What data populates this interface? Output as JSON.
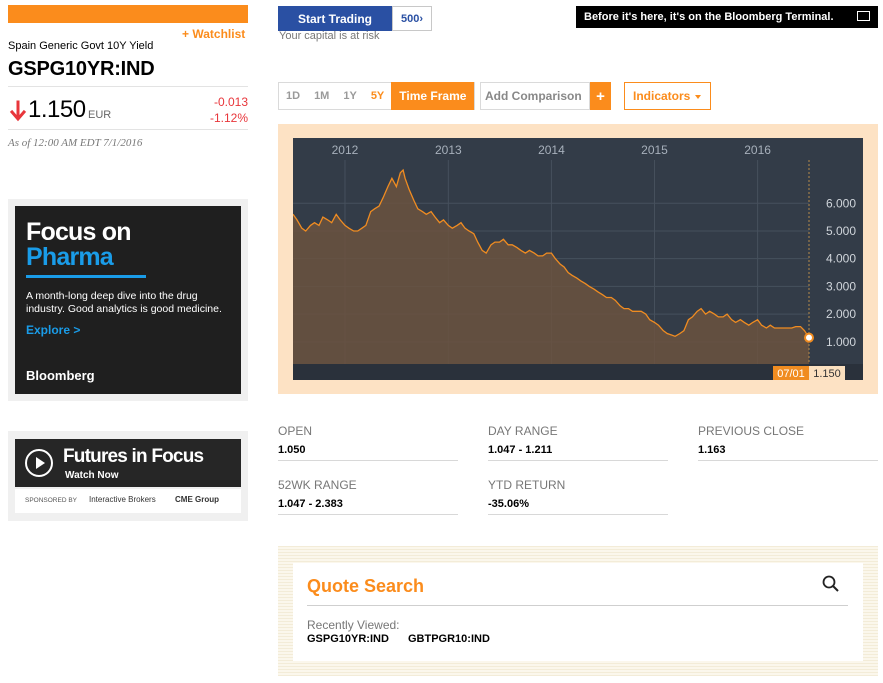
{
  "security": {
    "watchlist_label": "+ Watchlist",
    "name": "Spain Generic Govt 10Y Yield",
    "ticker": "GSPG10YR:IND",
    "price": "1.150",
    "currency": "EUR",
    "change_abs": "-0.013",
    "change_pct": "-1.12%",
    "as_of": "As of 12:00 AM EDT 7/1/2016",
    "direction_icon": "arrow-down-icon",
    "negative_color": "#e8363b"
  },
  "promo": {
    "start_trading": "Start Trading",
    "logo_text": "500›",
    "capital_risk": "Your capital is at risk",
    "terminal_banner": "Before it's here, it's on the Bloomberg Terminal."
  },
  "ads": {
    "pharma": {
      "title_line1": "Focus on",
      "title_line2": "Pharma",
      "body": "A month-long deep dive into the drug industry. Good analytics is good medicine.",
      "cta": "Explore >",
      "brand": "Bloomberg"
    },
    "futures": {
      "title": "Futures in Focus",
      "cta": "Watch Now",
      "sponsored_by": "SPONSORED BY",
      "sponsor1": "Interactive Brokers",
      "sponsor2": "CME Group"
    }
  },
  "toolbar": {
    "timeframes": [
      "1D",
      "1M",
      "1Y",
      "5Y"
    ],
    "active_timeframe": "5Y",
    "timeframe_label": "Time Frame",
    "compare_label": "Add Comparison",
    "compare_plus": "+",
    "indicators_label": "Indicators",
    "accent": "#fb8c1c"
  },
  "chart_data": {
    "type": "area",
    "x_ticks": [
      "2012",
      "2013",
      "2014",
      "2015",
      "2016"
    ],
    "y_ticks": [
      "6.000",
      "5.000",
      "4.000",
      "3.000",
      "2.000",
      "1.000"
    ],
    "ylim": [
      0.2,
      7.2
    ],
    "grid": true,
    "line_color": "#f08c21",
    "fill_color": "#6b5240",
    "background": "#333c48",
    "cursor_date": "07/01",
    "cursor_value": "1.150",
    "x": [
      "2011-07-01",
      "2011-07-15",
      "2011-08-01",
      "2011-08-15",
      "2011-09-01",
      "2011-09-15",
      "2011-10-01",
      "2011-10-15",
      "2011-11-01",
      "2011-11-15",
      "2011-12-01",
      "2011-12-15",
      "2012-01-01",
      "2012-01-15",
      "2012-02-01",
      "2012-02-15",
      "2012-03-01",
      "2012-03-15",
      "2012-04-01",
      "2012-04-15",
      "2012-05-01",
      "2012-05-15",
      "2012-06-01",
      "2012-06-15",
      "2012-07-01",
      "2012-07-15",
      "2012-07-25",
      "2012-08-01",
      "2012-08-15",
      "2012-09-01",
      "2012-09-15",
      "2012-10-01",
      "2012-10-15",
      "2012-11-01",
      "2012-11-15",
      "2012-12-01",
      "2012-12-15",
      "2013-01-01",
      "2013-01-15",
      "2013-02-01",
      "2013-02-15",
      "2013-03-01",
      "2013-03-15",
      "2013-04-01",
      "2013-04-15",
      "2013-05-01",
      "2013-05-15",
      "2013-06-01",
      "2013-06-15",
      "2013-07-01",
      "2013-07-15",
      "2013-08-01",
      "2013-08-15",
      "2013-09-01",
      "2013-09-15",
      "2013-10-01",
      "2013-10-15",
      "2013-11-01",
      "2013-11-15",
      "2013-12-01",
      "2013-12-15",
      "2014-01-01",
      "2014-01-15",
      "2014-02-01",
      "2014-02-15",
      "2014-03-01",
      "2014-03-15",
      "2014-04-01",
      "2014-04-15",
      "2014-05-01",
      "2014-05-15",
      "2014-06-01",
      "2014-06-15",
      "2014-07-01",
      "2014-07-15",
      "2014-08-01",
      "2014-08-15",
      "2014-09-01",
      "2014-09-15",
      "2014-10-01",
      "2014-10-15",
      "2014-11-01",
      "2014-11-15",
      "2014-12-01",
      "2014-12-15",
      "2015-01-01",
      "2015-01-15",
      "2015-02-01",
      "2015-02-15",
      "2015-03-01",
      "2015-03-15",
      "2015-04-01",
      "2015-04-15",
      "2015-05-01",
      "2015-05-15",
      "2015-06-01",
      "2015-06-15",
      "2015-07-01",
      "2015-07-15",
      "2015-08-01",
      "2015-08-15",
      "2015-09-01",
      "2015-09-15",
      "2015-10-01",
      "2015-10-15",
      "2015-11-01",
      "2015-11-15",
      "2015-12-01",
      "2015-12-15",
      "2016-01-01",
      "2016-01-15",
      "2016-02-01",
      "2016-02-15",
      "2016-03-01",
      "2016-03-15",
      "2016-04-01",
      "2016-04-15",
      "2016-05-01",
      "2016-05-15",
      "2016-06-01",
      "2016-06-15",
      "2016-07-01"
    ],
    "series": [
      {
        "values": [
          5.6,
          5.4,
          5.1,
          5.0,
          5.2,
          5.3,
          5.2,
          5.5,
          5.4,
          5.3,
          5.6,
          5.4,
          5.2,
          5.1,
          5.0,
          5.0,
          5.1,
          5.2,
          5.7,
          5.8,
          5.9,
          6.2,
          6.6,
          6.9,
          6.6,
          7.1,
          7.2,
          6.9,
          6.5,
          6.1,
          5.8,
          5.7,
          5.6,
          5.7,
          5.5,
          5.3,
          5.4,
          5.2,
          5.1,
          5.2,
          5.3,
          5.1,
          5.0,
          4.9,
          4.6,
          4.3,
          4.2,
          4.5,
          4.6,
          4.6,
          4.7,
          4.5,
          4.5,
          4.4,
          4.3,
          4.2,
          4.3,
          4.2,
          4.1,
          4.1,
          4.2,
          4.2,
          4.0,
          3.8,
          3.7,
          3.5,
          3.4,
          3.3,
          3.2,
          3.1,
          3.0,
          2.9,
          2.8,
          2.7,
          2.6,
          2.6,
          2.5,
          2.3,
          2.2,
          2.2,
          2.1,
          2.1,
          2.1,
          2.0,
          1.8,
          1.7,
          1.6,
          1.4,
          1.3,
          1.25,
          1.2,
          1.3,
          1.4,
          1.8,
          1.9,
          2.1,
          2.2,
          2.0,
          2.1,
          2.0,
          1.9,
          1.9,
          2.0,
          1.8,
          1.7,
          1.8,
          1.7,
          1.6,
          1.7,
          1.8,
          1.6,
          1.5,
          1.6,
          1.5,
          1.5,
          1.5,
          1.5,
          1.5,
          1.55,
          1.55,
          1.4,
          1.15
        ]
      }
    ]
  },
  "stats": [
    {
      "label": "OPEN",
      "value": "1.050"
    },
    {
      "label": "DAY RANGE",
      "value": "1.047 - 1.211"
    },
    {
      "label": "PREVIOUS CLOSE",
      "value": "1.163"
    },
    {
      "label": "52WK RANGE",
      "value": "1.047 - 2.383"
    },
    {
      "label": "YTD RETURN",
      "value": "-35.06%"
    }
  ],
  "quote_search": {
    "title": "Quote Search",
    "recent_label": "Recently Viewed:",
    "recent": [
      "GSPG10YR:IND",
      "GBTPGR10:IND"
    ]
  }
}
